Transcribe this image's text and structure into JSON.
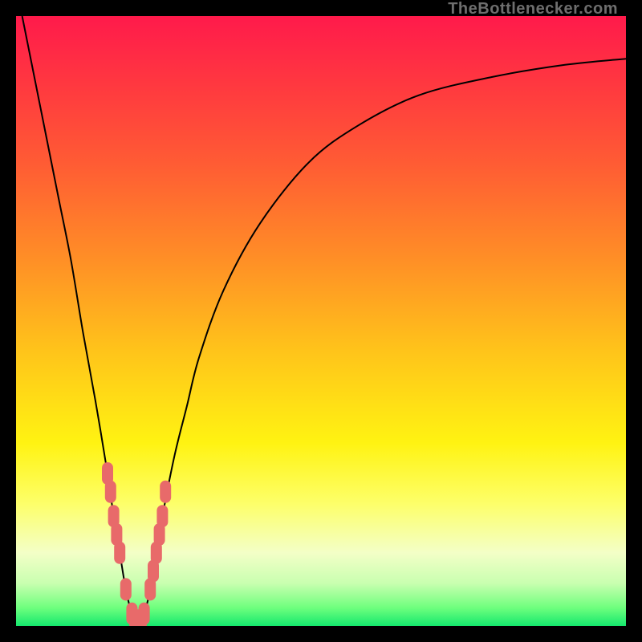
{
  "watermark": "TheBottlenecker.com",
  "chart_data": {
    "type": "line",
    "title": "",
    "xlabel": "",
    "ylabel": "",
    "xlim": [
      0,
      100
    ],
    "ylim": [
      0,
      100
    ],
    "series": [
      {
        "name": "bottleneck-curve",
        "x": [
          1,
          3,
          5,
          7,
          9,
          11,
          13,
          15,
          16,
          17,
          18,
          19,
          20,
          21,
          22,
          23,
          24,
          26,
          28,
          30,
          34,
          40,
          48,
          56,
          66,
          78,
          90,
          100
        ],
        "values": [
          100,
          90,
          80,
          70,
          60,
          48,
          37,
          25,
          18,
          12,
          6,
          2,
          0,
          2,
          6,
          12,
          18,
          28,
          36,
          44,
          55,
          66,
          76,
          82,
          87,
          90,
          92,
          93
        ]
      }
    ],
    "markers": {
      "name": "highlight-points",
      "x": [
        15,
        15.5,
        16,
        16.5,
        17,
        18,
        19,
        19.5,
        20,
        20.5,
        21,
        22,
        22.5,
        23,
        23.5,
        24,
        24.5
      ],
      "values": [
        25,
        22,
        18,
        15,
        12,
        6,
        2,
        1,
        0,
        1,
        2,
        6,
        9,
        12,
        15,
        18,
        22
      ]
    },
    "legend": null
  }
}
